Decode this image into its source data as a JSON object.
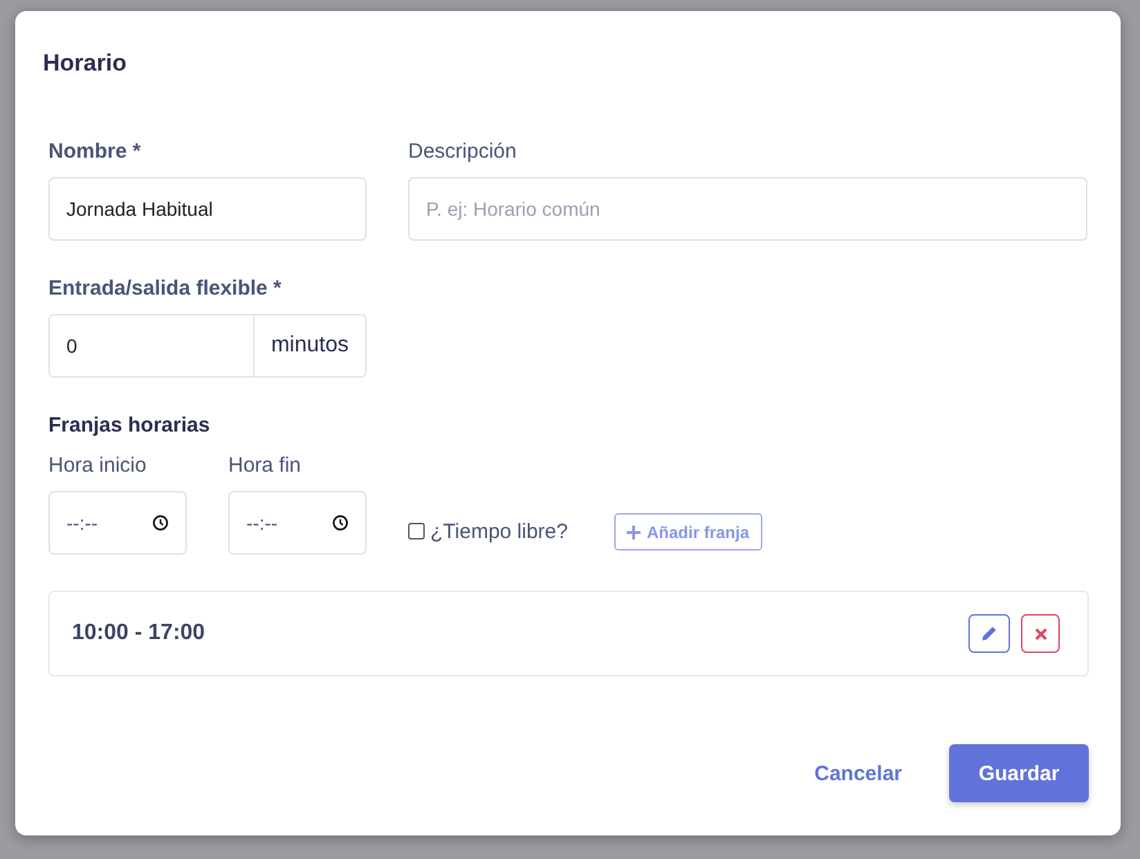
{
  "dialog": {
    "title": "Horario"
  },
  "fields": {
    "name": {
      "label": "Nombre *",
      "value": "Jornada Habitual"
    },
    "description": {
      "label": "Descripción",
      "placeholder": "P. ej: Horario común"
    },
    "flex": {
      "label": "Entrada/salida flexible *",
      "value": "0",
      "unit": "minutos"
    }
  },
  "slots_section": {
    "title": "Franjas horarias",
    "start": {
      "label": "Hora inicio",
      "placeholder": "--:--"
    },
    "end": {
      "label": "Hora fin",
      "placeholder": "--:--"
    },
    "free_time": {
      "label": "¿Tiempo libre?",
      "checked": false
    },
    "add_button": "Añadir franja"
  },
  "slots": [
    {
      "label": "10:00 - 17:00"
    }
  ],
  "footer": {
    "cancel": "Cancelar",
    "save": "Guardar"
  }
}
